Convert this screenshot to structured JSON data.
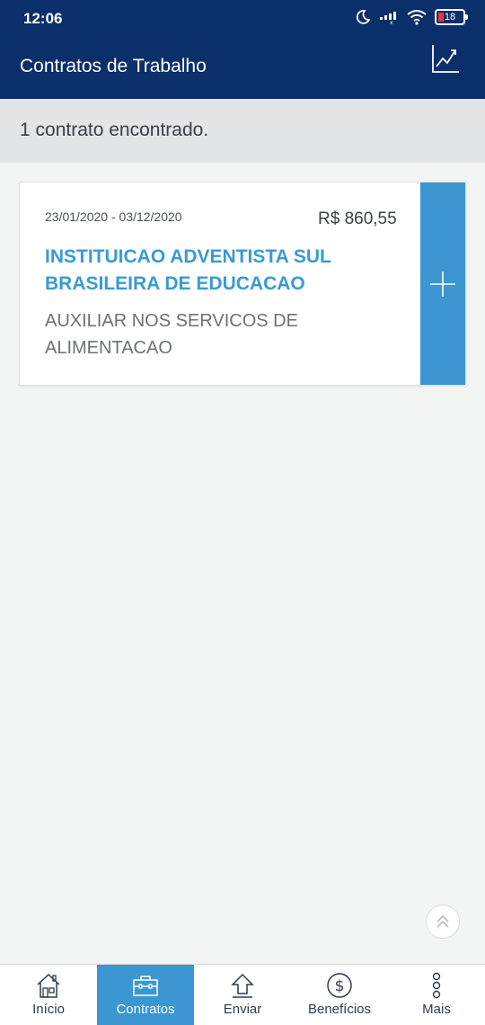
{
  "status_bar": {
    "time": "12:06",
    "battery": "18",
    "icons": [
      "moon-icon",
      "signal-icon",
      "wifi-icon",
      "battery-icon"
    ]
  },
  "header": {
    "title": "Contratos de Trabalho",
    "action_icon": "chart-icon"
  },
  "summary": {
    "text": "1 contrato encontrado."
  },
  "contract": {
    "period": "23/01/2020 - 03/12/2020",
    "salary": "R$ 860,55",
    "employer": "INSTITUICAO ADVENTISTA SUL BRASILEIRA DE EDUCACAO",
    "role": "AUXILIAR NOS SERVICOS DE ALIMENTACAO",
    "expand_icon": "plus-icon"
  },
  "bottom_nav": {
    "items": [
      {
        "label": "Início",
        "icon": "home-icon",
        "active": false
      },
      {
        "label": "Contratos",
        "icon": "briefcase-icon",
        "active": true
      },
      {
        "label": "Enviar",
        "icon": "upload-arrow-icon",
        "active": false
      },
      {
        "label": "Benefícios",
        "icon": "dollar-coin-icon",
        "active": false
      },
      {
        "label": "Mais",
        "icon": "more-dots-icon",
        "active": false
      }
    ]
  },
  "colors": {
    "header_bg": "#0b2f6b",
    "accent": "#3b96d2",
    "employer_text": "#3a9ad4",
    "page_bg": "#f3f4f4"
  }
}
